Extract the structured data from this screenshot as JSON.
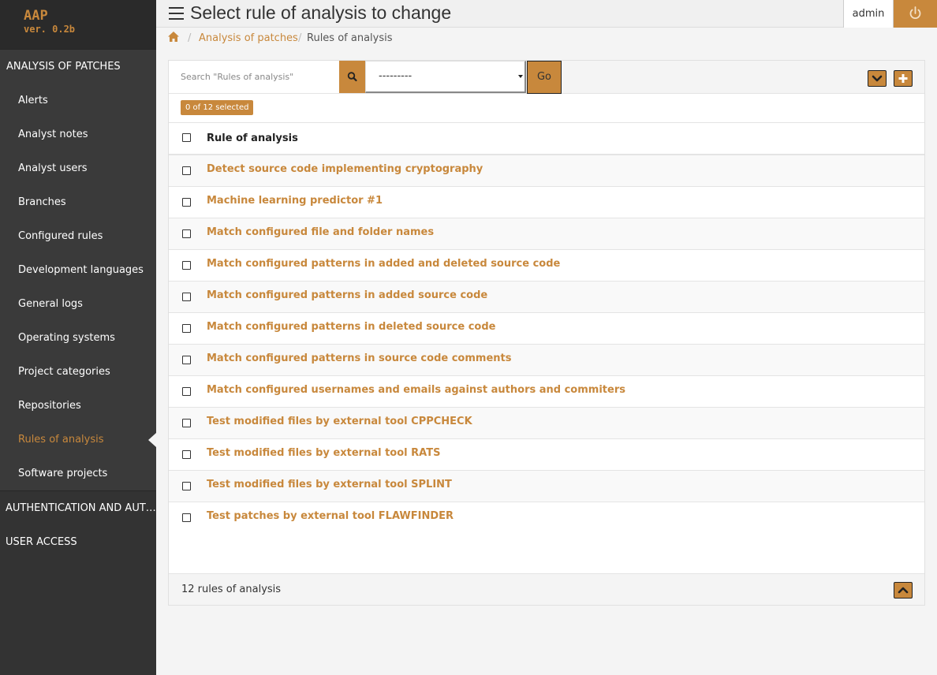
{
  "brand": {
    "name": "AAP",
    "version": "ver. 0.2b"
  },
  "header": {
    "title": "Select rule of analysis to change",
    "user": "admin"
  },
  "breadcrumb": {
    "items": [
      "Analysis of patches",
      "Rules of analysis"
    ],
    "separator": "/"
  },
  "sidebar": {
    "section_main": "ANALYSIS OF PATCHES",
    "items": [
      {
        "label": "Alerts"
      },
      {
        "label": "Analyst notes"
      },
      {
        "label": "Analyst users"
      },
      {
        "label": "Branches"
      },
      {
        "label": "Configured rules"
      },
      {
        "label": "Development languages"
      },
      {
        "label": "General logs"
      },
      {
        "label": "Operating systems"
      },
      {
        "label": "Project categories"
      },
      {
        "label": "Repositories"
      },
      {
        "label": "Rules of analysis",
        "active": true
      },
      {
        "label": "Software projects"
      }
    ],
    "section_auth": "AUTHENTICATION AND AUTHORIZATION",
    "section_user": "USER ACCESS"
  },
  "toolbar": {
    "search_placeholder": "Search \"Rules of analysis\"",
    "action_value": "---------",
    "go_label": "Go"
  },
  "selection": {
    "text": "0 of 12 selected"
  },
  "table": {
    "column": "Rule of analysis",
    "rows": [
      "Detect source code implementing cryptography",
      "Machine learning predictor #1",
      "Match configured file and folder names",
      "Match configured patterns in added and deleted source code",
      "Match configured patterns in added source code",
      "Match configured patterns in deleted source code",
      "Match configured patterns in source code comments",
      "Match configured usernames and emails against authors and commiters",
      "Test modified files by external tool CPPCHECK",
      "Test modified files by external tool RATS",
      "Test modified files by external tool SPLINT",
      "Test patches by external tool FLAWFINDER"
    ]
  },
  "footer": {
    "count": "12 rules of analysis"
  },
  "icons": {
    "menu": "hamburger-icon",
    "logout": "power-icon",
    "home": "home-icon",
    "search": "search-icon",
    "collapse": "chevron-down-icon",
    "add": "plus-icon",
    "scroll_top": "chevron-up-icon"
  },
  "colors": {
    "accent": "#c8883c",
    "sidebar": "#333333",
    "background": "#f4f4f4"
  }
}
